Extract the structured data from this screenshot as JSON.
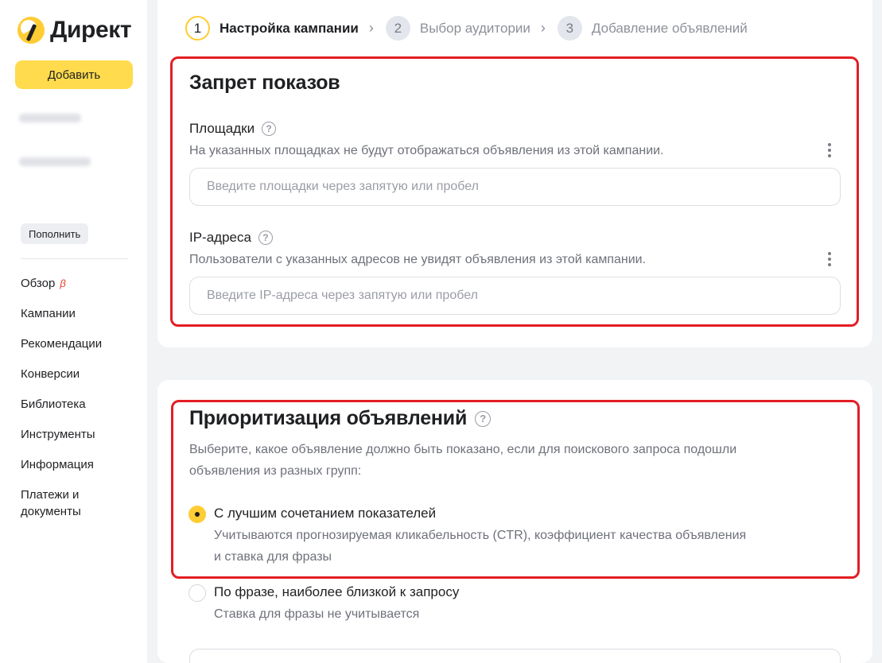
{
  "sidebar": {
    "logo_text": "Директ",
    "add_button": "Добавить",
    "topup_button": "Пополнить",
    "nav": [
      {
        "label": "Обзор",
        "badge": "β"
      },
      {
        "label": "Кампании"
      },
      {
        "label": "Рекомендации"
      },
      {
        "label": "Конверсии"
      },
      {
        "label": "Библиотека"
      },
      {
        "label": "Инструменты"
      },
      {
        "label": "Информация"
      },
      {
        "label": "Платежи и документы"
      }
    ]
  },
  "steps": [
    {
      "num": "1",
      "label": "Настройка кампании",
      "state": "active"
    },
    {
      "num": "2",
      "label": "Выбор аудитории",
      "state": "inactive"
    },
    {
      "num": "3",
      "label": "Добавление объявлений",
      "state": "inactive"
    }
  ],
  "ban_section": {
    "title": "Запрет показов",
    "sites": {
      "label": "Площадки",
      "description": "На указанных площадках не будут отображаться объявления из этой кампании.",
      "placeholder": "Введите площадки через запятую или пробел",
      "value": ""
    },
    "ips": {
      "label": "IP-адреса",
      "description": "Пользователи с указанных адресов не увидят объявления из этой кампании.",
      "placeholder": "Введите IP-адреса через запятую или пробел",
      "value": ""
    }
  },
  "priority_section": {
    "title": "Приоритизация объявлений",
    "description_line1": "Выберите, какое объявление должно быть показано, если для поискового запроса подошли",
    "description_line2": "объявления из разных групп:",
    "options": [
      {
        "title": "С лучшим сочетанием показателей",
        "desc_line1": "Учитываются прогнозируемая кликабельность (CTR), коэффициент качества объявления",
        "desc_line2": "и ставка для фразы",
        "selected": true
      },
      {
        "title": "По фразе, наиболее близкой к запросу",
        "desc_line1": "Ставка для фразы не учитывается",
        "selected": false
      }
    ]
  },
  "colors": {
    "accent_yellow": "#ffdb4d",
    "highlight_red": "#e31e24",
    "beta_red": "#e63d2e"
  }
}
